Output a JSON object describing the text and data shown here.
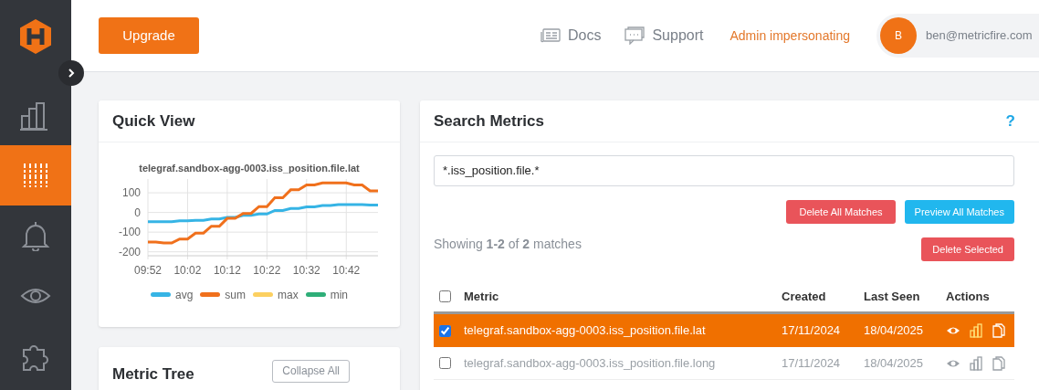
{
  "sidebar": {
    "items": [
      {
        "kind": "bar-chart",
        "selected": false
      },
      {
        "kind": "metrics",
        "selected": true
      },
      {
        "kind": "bell",
        "selected": false
      },
      {
        "kind": "eye",
        "selected": false
      },
      {
        "kind": "puzzle",
        "selected": false
      }
    ]
  },
  "topbar": {
    "upgrade": "Upgrade",
    "links": [
      {
        "kind": "docs",
        "label": "Docs"
      },
      {
        "kind": "support",
        "label": "Support"
      }
    ],
    "admin": "Admin impersonating",
    "user": {
      "initial": "B",
      "email": "ben@metricfire.com"
    }
  },
  "quick_view": {
    "title": "Quick View",
    "chart_data": {
      "type": "line",
      "title": "telegraf.sandbox-agg-0003.iss_position.file.lat",
      "categories": [
        "09:52",
        null,
        null,
        null,
        null,
        "10:02",
        null,
        null,
        null,
        null,
        "10:12",
        null,
        null,
        null,
        null,
        "10:22",
        null,
        null,
        null,
        null,
        "10:32",
        null,
        null,
        null,
        null,
        "10:42",
        null,
        null,
        null,
        null
      ],
      "yticks": [
        100,
        0,
        -100,
        -200
      ],
      "ylim": [
        -220,
        170
      ],
      "grid": true,
      "legend": true,
      "series": [
        {
          "name": "avg",
          "color": "#36b4e5",
          "values": [
            -47,
            -47,
            -47,
            -47,
            -42,
            -42,
            -40,
            -40,
            -33,
            -33,
            -25,
            -25,
            -15,
            -15,
            -8,
            -8,
            10,
            10,
            20,
            20,
            28,
            28,
            35,
            35,
            40,
            40,
            40,
            40,
            38,
            38
          ]
        },
        {
          "name": "sum",
          "color": "#f0701c",
          "values": [
            -150,
            -150,
            -155,
            -155,
            -135,
            -135,
            -105,
            -105,
            -70,
            -70,
            -30,
            -30,
            -5,
            -5,
            30,
            30,
            75,
            75,
            115,
            115,
            140,
            140,
            150,
            150,
            150,
            150,
            140,
            140,
            110,
            110
          ]
        },
        {
          "name": "max",
          "color": "#fcd060",
          "values": [
            null,
            null,
            null,
            null,
            null,
            null,
            null,
            null,
            null,
            null,
            null,
            null,
            null,
            null,
            null,
            null,
            null,
            null,
            null,
            null,
            null,
            null,
            null,
            null,
            null,
            null,
            null,
            null,
            null,
            null
          ]
        },
        {
          "name": "min",
          "color": "#2eae78",
          "values": [
            null,
            null,
            null,
            null,
            null,
            null,
            null,
            null,
            null,
            null,
            null,
            null,
            null,
            null,
            null,
            null,
            null,
            null,
            null,
            null,
            null,
            null,
            null,
            null,
            null,
            null,
            null,
            null,
            null,
            null
          ]
        }
      ]
    }
  },
  "metric_tree": {
    "title": "Metric Tree",
    "collapse_button": "Collapse All"
  },
  "search_metrics": {
    "title": "Search Metrics",
    "help": "?",
    "query": "*.iss_position.file.*",
    "delete_all": "Delete All Matches",
    "preview_all": "Preview All Matches",
    "summary": "Showing **1-2** of **2** matches",
    "delete_selected": "Delete Selected",
    "table": {
      "select_all_checked": false,
      "columns": [
        "Metric",
        "Created",
        "Last Seen",
        "Actions"
      ],
      "rows": [
        {
          "metric": "telegraf.sandbox-agg-0003.iss_position.file.lat",
          "created": "17/11/2024",
          "last_seen": "18/04/2025",
          "checked": true,
          "selected": true
        },
        {
          "metric": "telegraf.sandbox-agg-0003.iss_position.file.long",
          "created": "17/11/2024",
          "last_seen": "18/04/2025",
          "checked": false,
          "selected": false
        }
      ]
    }
  }
}
